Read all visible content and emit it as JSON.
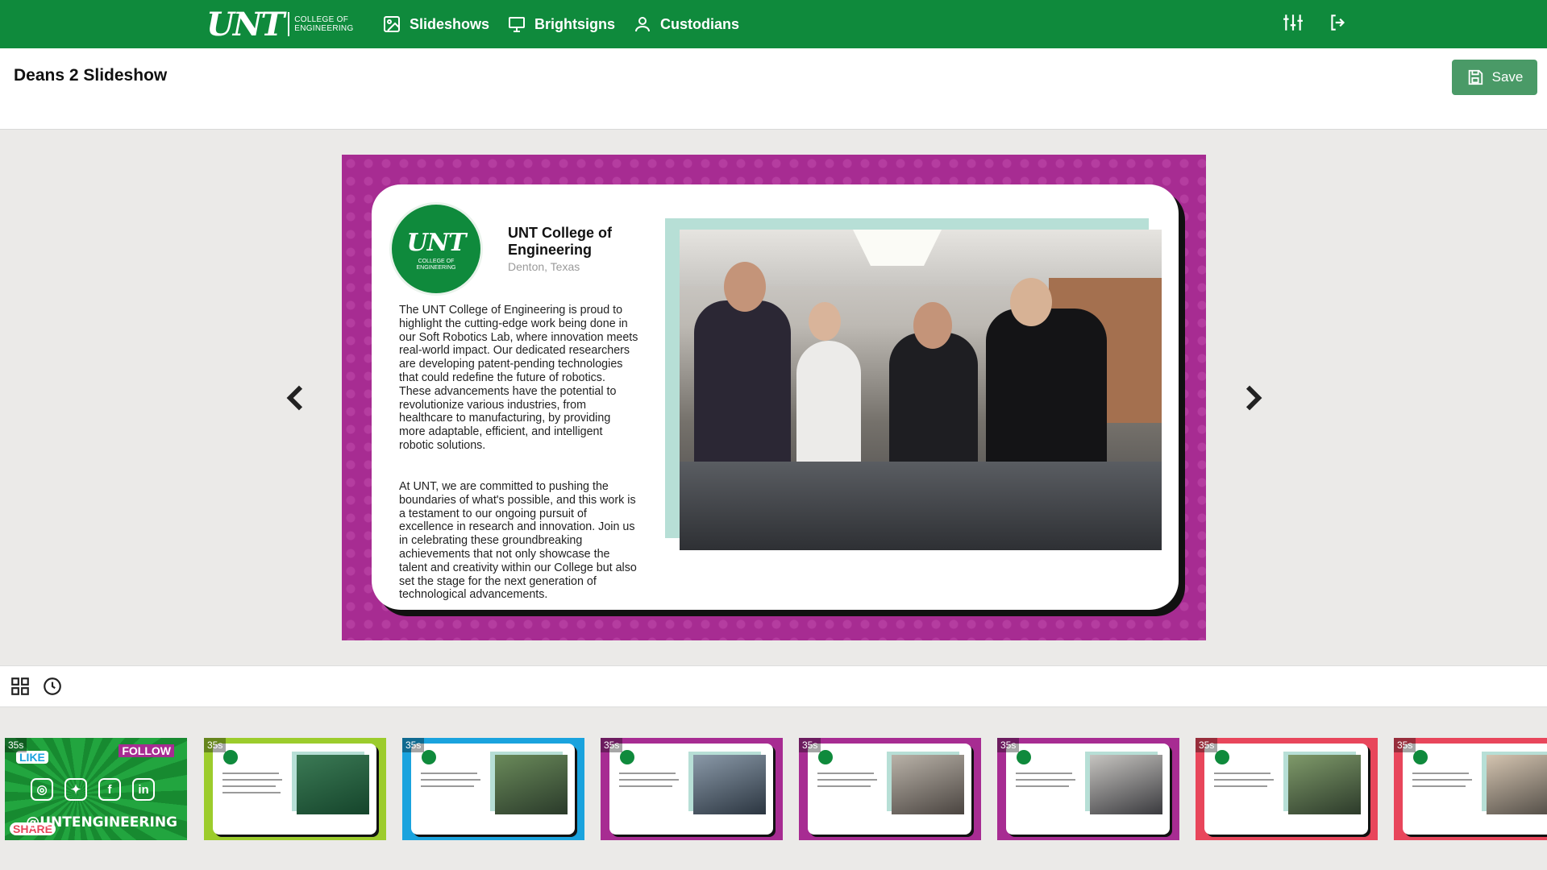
{
  "brand": {
    "mark": "UNT",
    "sub1": "COLLEGE OF",
    "sub2": "ENGINEERING"
  },
  "nav": [
    {
      "label": "Slideshows",
      "icon": "image-icon"
    },
    {
      "label": "Brightsigns",
      "icon": "monitor-icon"
    },
    {
      "label": "Custodians",
      "icon": "user-icon"
    }
  ],
  "header": {
    "title": "Deans 2 Slideshow",
    "save_label": "Save"
  },
  "slide": {
    "badge_mark": "UNT",
    "badge_sub1": "COLLEGE OF",
    "badge_sub2": "ENGINEERING",
    "org_name": "UNT College of Engineering",
    "org_location": "Denton, Texas",
    "paragraph1": "The UNT College of Engineering is proud to highlight the cutting-edge work being done in our Soft Robotics Lab, where innovation meets real-world impact. Our dedicated researchers are developing patent-pending technologies that could redefine the future of robotics. These advancements have the potential to revolutionize various industries, from healthcare to manufacturing, by providing more adaptable, efficient, and intelligent robotic solutions.",
    "paragraph2": "At UNT, we are committed to pushing the boundaries of what's possible, and this work is a testament to our ongoing pursuit of excellence in research and innovation. Join us in celebrating these groundbreaking achievements that not only showcase the talent and creativity within our College but also set the stage for the next generation of technological advancements."
  },
  "thumbnails": [
    {
      "duration": "35s",
      "color": "#1d9b39",
      "kind": "follow",
      "follow": "FOLLOW",
      "like": "LIKE",
      "share": "SHARE",
      "handle": "@UNTENGINEERING"
    },
    {
      "duration": "35s",
      "color": "#9ccc2c"
    },
    {
      "duration": "35s",
      "color": "#1aa3de"
    },
    {
      "duration": "35s",
      "color": "#a72c92"
    },
    {
      "duration": "35s",
      "color": "#a72c92"
    },
    {
      "duration": "35s",
      "color": "#a72c92"
    },
    {
      "duration": "35s",
      "color": "#e8465b"
    },
    {
      "duration": "35s",
      "color": "#e8465b"
    }
  ]
}
